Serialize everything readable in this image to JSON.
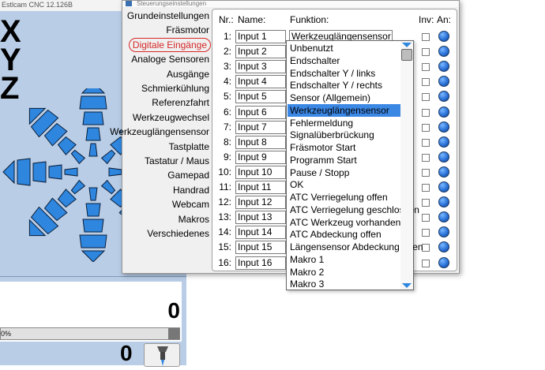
{
  "main_window": {
    "title": "Estlcam CNC 12.126B",
    "axes": [
      "X",
      "Y",
      "Z"
    ],
    "dro_value_top": "0",
    "dro_value_bottom": "0",
    "progress_text": "0%",
    "progress_fraction": 0
  },
  "dialog": {
    "title": "Steuerungseinstellungen",
    "nav": [
      "Grundeinstellungen",
      "Fräsmotor",
      "Digitale Eingänge",
      "Analoge Sensoren",
      "Ausgänge",
      "Schmierkühlung",
      "Referenzfahrt",
      "Werkzeugwechsel",
      "Werkzeuglängensensor",
      "Tastplatte",
      "Tastatur / Maus",
      "Gamepad",
      "Handrad",
      "Webcam",
      "Makros",
      "Verschiedenes"
    ],
    "active_nav": "Digitale Eingänge",
    "headers": {
      "nr": "Nr.:",
      "name": "Name:",
      "funktion": "Funktion:",
      "inv": "Inv:",
      "an": "An:"
    },
    "rows": [
      {
        "nr": "1:",
        "name": "Input 1"
      },
      {
        "nr": "2:",
        "name": "Input 2"
      },
      {
        "nr": "3:",
        "name": "Input 3"
      },
      {
        "nr": "4:",
        "name": "Input 4"
      },
      {
        "nr": "5:",
        "name": "Input 5"
      },
      {
        "nr": "6:",
        "name": "Input 6"
      },
      {
        "nr": "7:",
        "name": "Input 7"
      },
      {
        "nr": "8:",
        "name": "Input 8"
      },
      {
        "nr": "9:",
        "name": "Input 9"
      },
      {
        "nr": "10:",
        "name": "Input 10"
      },
      {
        "nr": "11:",
        "name": "Input 11"
      },
      {
        "nr": "12:",
        "name": "Input 12"
      },
      {
        "nr": "13:",
        "name": "Input 13"
      },
      {
        "nr": "14:",
        "name": "Input 14"
      },
      {
        "nr": "15:",
        "name": "Input 15"
      },
      {
        "nr": "16:",
        "name": "Input 16"
      }
    ],
    "function_select_value": "Werkzeuglängensensor"
  },
  "dropdown": {
    "options": [
      "Unbenutzt",
      "Endschalter",
      "Endschalter Y / links",
      "Endschalter Y / rechts",
      "Sensor (Allgemein)",
      "Werkzeuglängensensor",
      "Fehlermeldung",
      "Signalüberbrückung",
      "Fräsmotor Start",
      "Programm Start",
      "Pause / Stopp",
      "OK",
      "ATC Verriegelung offen",
      "ATC Verriegelung geschlossen",
      "ATC Werkzeug vorhanden",
      "ATC Abdeckung offen",
      "Längensensor Abdeckung offen",
      "Makro 1",
      "Makro 2",
      "Makro 3"
    ],
    "selected": "Werkzeuglängensensor"
  },
  "icons": {
    "jog_arrow": "jog-arrow-icon",
    "scroll_up": "scroll-up-icon",
    "scroll_down": "scroll-down-icon",
    "dropdown": "chevron-down-icon",
    "tool": "tool-icon"
  },
  "colors": {
    "accent": "#2e86de",
    "highlight": "#3b87e4",
    "active_nav": "#d62828",
    "main_bg": "#b9cde6"
  }
}
